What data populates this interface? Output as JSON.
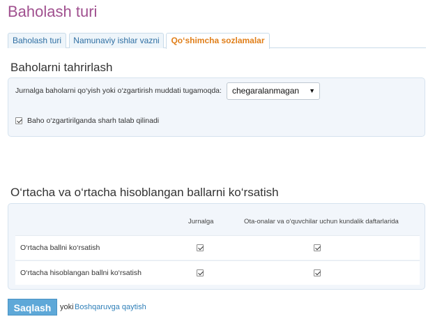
{
  "page": {
    "title": "Baholash turi"
  },
  "tabs": [
    {
      "label": "Baholash turi",
      "active": false
    },
    {
      "label": "Namunaviy ishlar vazni",
      "active": false
    },
    {
      "label": "Qo‘shimcha sozlamalar",
      "active": true
    }
  ],
  "grade_editing": {
    "title": "Baholarni tahrirlash",
    "deadline_label": "Jurnalga baholarni qo‘yish yoki o‘zgartirish muddati tugamoqda:",
    "deadline_value": "chegaralanmagan",
    "comment_required_label": "Baho o‘zgartirilganda sharh talab qilinadi",
    "comment_required_checked": true
  },
  "averages": {
    "title": "O‘rtacha va o‘rtacha hisoblangan ballarni ko‘rsatish",
    "columns": [
      "Jurnalga",
      "Ota-onalar va o‘quvchilar uchun kundalik daftarlarida"
    ],
    "rows": [
      {
        "label": "O‘rtacha ballni ko‘rsatish",
        "journal": true,
        "diary": true
      },
      {
        "label": "O‘rtacha hisoblangan ballni ko‘rsatish",
        "journal": true,
        "diary": true
      }
    ]
  },
  "footer": {
    "save_label": "Saqlash",
    "or_text": "yoki",
    "back_link": "Boshqaruvga qaytish"
  },
  "icons": {
    "select_arrow": "chevron-down-icon",
    "checkbox": "check-icon"
  },
  "colors": {
    "title": "#a0508f",
    "active_tab": "#e07f1a",
    "link": "#2f7fb8",
    "button": "#5ea8d8",
    "panel": "#f2f6fb"
  }
}
